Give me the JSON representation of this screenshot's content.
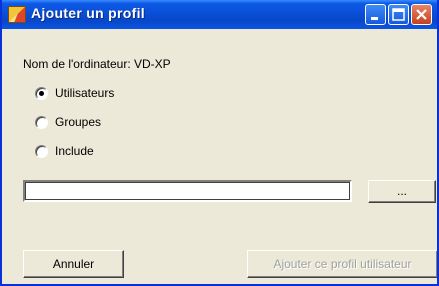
{
  "window": {
    "title": "Ajouter un profil"
  },
  "computer": {
    "label": "Nom de l'ordinateur: VD-XP"
  },
  "options": [
    {
      "label": "Utilisateurs",
      "selected": true
    },
    {
      "label": "Groupes",
      "selected": false
    },
    {
      "label": "Include",
      "selected": false
    }
  ],
  "path_field": {
    "value": ""
  },
  "buttons": {
    "browse": "...",
    "cancel": "Annuler",
    "add": "Ajouter ce profil utilisateur"
  },
  "colors": {
    "titlebar": "#0a4fd8",
    "face": "#ece9d8",
    "close": "#c4401f"
  }
}
